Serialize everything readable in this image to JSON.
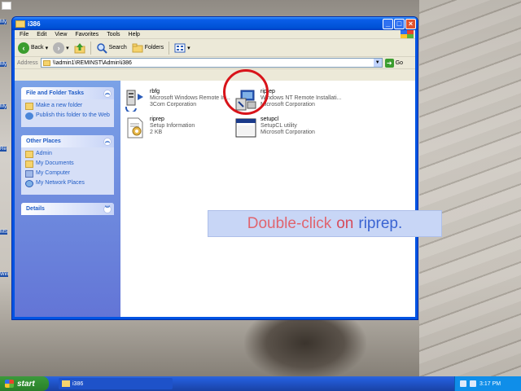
{
  "desktop": {
    "icons": [
      "My",
      "My",
      "My",
      "Re",
      "MS",
      "Win"
    ]
  },
  "window": {
    "title": "i386",
    "menu": [
      "File",
      "Edit",
      "View",
      "Favorites",
      "Tools",
      "Help"
    ],
    "toolbar": {
      "back": "Back",
      "search": "Search",
      "folders": "Folders"
    },
    "address": {
      "label": "Address",
      "path": "\\\\admin1\\REMINST\\Admin\\i386",
      "go": "Go"
    }
  },
  "tasks_panel": {
    "title": "File and Folder Tasks",
    "links": [
      "Make a new folder",
      "Publish this folder to the Web"
    ]
  },
  "places_panel": {
    "title": "Other Places",
    "links": [
      "Admin",
      "My Documents",
      "My Computer",
      "My Network Places"
    ]
  },
  "details_panel": {
    "title": "Details"
  },
  "files": [
    {
      "name": "rbfg",
      "line2": "Microsoft Windows Remote In...",
      "line3": "3Com Corporation"
    },
    {
      "name": "riprep",
      "line2": "Windows NT Remote Installati...",
      "line3": "Microsoft Corporation"
    },
    {
      "name": "riprep",
      "line2": "Setup Information",
      "line3": "2 KB"
    },
    {
      "name": "setupcl",
      "line2": "SetupCL utility",
      "line3": "Microsoft Corporation"
    }
  ],
  "callout": {
    "part1": "Double-click",
    "part2": "on",
    "part3": "riprep."
  },
  "taskbar": {
    "start": "start",
    "task": "i386",
    "clock": "3:17 PM"
  },
  "colors": {
    "highlight": "#d8141a",
    "title_blue": "#0054e3",
    "link_blue": "#215dc6"
  }
}
